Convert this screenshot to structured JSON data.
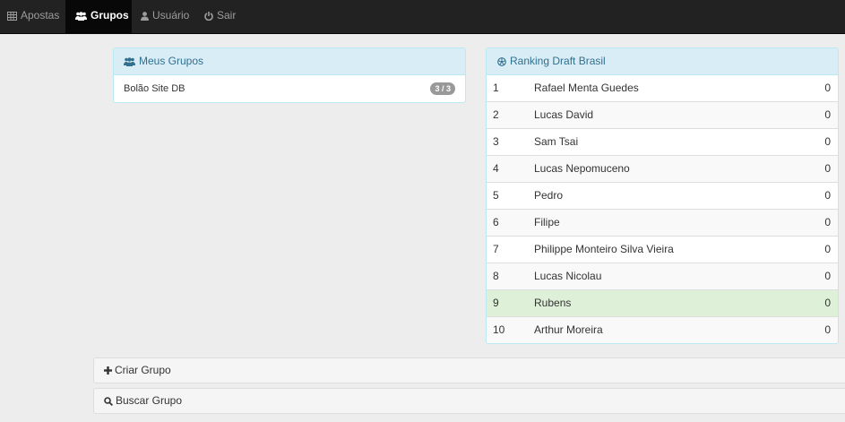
{
  "nav": {
    "items": [
      {
        "label": "Apostas",
        "icon": "table-icon"
      },
      {
        "label": "Grupos",
        "icon": "users-icon",
        "active": true
      },
      {
        "label": "Usuário",
        "icon": "user-icon"
      },
      {
        "label": "Sair",
        "icon": "power-icon"
      }
    ]
  },
  "my_groups": {
    "title": "Meus Grupos",
    "groups": [
      {
        "name": "Bolão Site DB",
        "count": "3 / 3"
      }
    ]
  },
  "ranking": {
    "title": "Ranking Draft Brasil",
    "rows": [
      {
        "pos": "1",
        "name": "Rafael Menta Guedes",
        "points": "0"
      },
      {
        "pos": "2",
        "name": "Lucas David",
        "points": "0"
      },
      {
        "pos": "3",
        "name": "Sam Tsai",
        "points": "0"
      },
      {
        "pos": "4",
        "name": "Lucas Nepomuceno",
        "points": "0"
      },
      {
        "pos": "5",
        "name": "Pedro",
        "points": "0"
      },
      {
        "pos": "6",
        "name": "Filipe",
        "points": "0"
      },
      {
        "pos": "7",
        "name": "Philippe Monteiro Silva Vieira",
        "points": "0"
      },
      {
        "pos": "8",
        "name": "Lucas Nicolau",
        "points": "0"
      },
      {
        "pos": "9",
        "name": "Rubens",
        "points": "0",
        "highlighted": true
      },
      {
        "pos": "10",
        "name": "Arthur Moreira",
        "points": "0"
      }
    ]
  },
  "actions": {
    "create_label": "Criar Grupo",
    "search_label": "Buscar Grupo"
  },
  "colors": {
    "navbar": "#222222",
    "panel_heading": "#d9edf7",
    "panel_text": "#31708f",
    "highlight_row": "#dff0d8"
  }
}
